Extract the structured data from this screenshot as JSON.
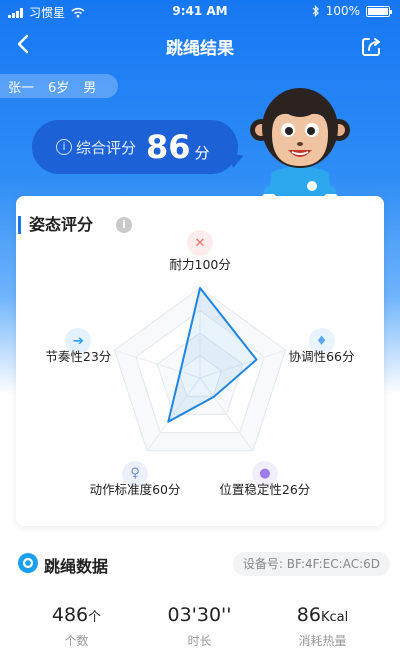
{
  "status_bar": {
    "carrier": "习惯星",
    "time": "9:41 AM",
    "battery": "100%"
  },
  "header": {
    "title": "跳绳结果"
  },
  "user": {
    "name": "张一",
    "age": "6岁",
    "gender": "男"
  },
  "score": {
    "info_icon": "i",
    "label": "综合评分",
    "value": "86",
    "unit": "分"
  },
  "posture": {
    "title": "姿态评分",
    "info_icon": "i",
    "dimensions": [
      {
        "label": "耐力100分",
        "score": 100,
        "icon": "endurance-icon",
        "color": "#f06d6d"
      },
      {
        "label": "协调性66分",
        "score": 66,
        "icon": "coordination-icon",
        "color": "#5aa8f0"
      },
      {
        "label": "位置稳定性26分",
        "score": 26,
        "icon": "stability-icon",
        "color": "#9a7de8"
      },
      {
        "label": "动作标准度60分",
        "score": 60,
        "icon": "standard-icon",
        "color": "#6a8fd8"
      },
      {
        "label": "节奏性23分",
        "score": 23,
        "icon": "rhythm-icon",
        "color": "#2e9cf0"
      }
    ]
  },
  "rope_data": {
    "title": "跳绳数据",
    "device_label": "设备号:",
    "device_id": "BF:4F:EC:AC:6D",
    "metrics": [
      {
        "value": "486",
        "unit": "个",
        "label": "个数"
      },
      {
        "value": "03'30''",
        "unit": "",
        "label": "时长"
      },
      {
        "value": "86",
        "unit": "Kcal",
        "label": "消耗热量"
      }
    ]
  },
  "colors": {
    "primary": "#1677f2",
    "bubble": "#1c61d6",
    "radar_stroke": "#1f86e0"
  }
}
